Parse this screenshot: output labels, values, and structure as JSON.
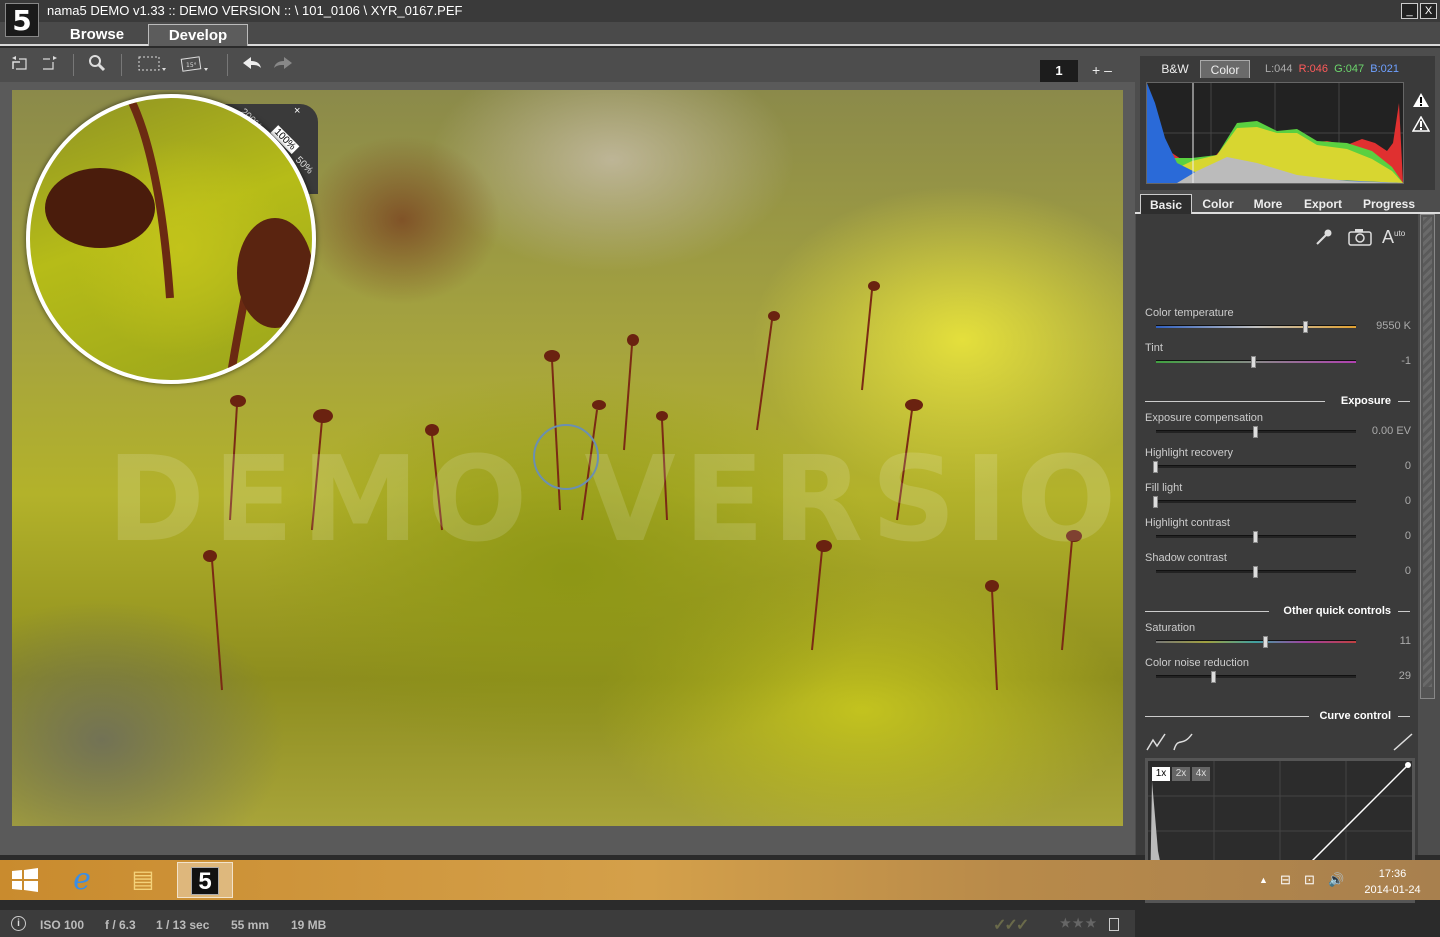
{
  "window": {
    "logo": "5",
    "title": "nama5 DEMO v1.33 :: DEMO VERSION :: \\ 101_0106 \\ XYR_0167.PEF",
    "minimize_glyph": "_",
    "close_glyph": "X"
  },
  "mode_tabs": {
    "browse": "Browse",
    "develop": "Develop",
    "active": "Develop"
  },
  "toolbar": {
    "page_number": "1",
    "zoom_controls": "+ –"
  },
  "image": {
    "watermark": "DEMO VERSION",
    "loupe": {
      "zoom_levels": [
        "200%",
        "100%",
        "50%"
      ],
      "selected_zoom": "100%",
      "close_glyph": "×"
    }
  },
  "status": {
    "info_glyph": "i",
    "iso": "ISO 100",
    "aperture": "f / 6.3",
    "shutter": "1 / 13 sec",
    "focal_length": "55 mm",
    "file_size": "19 MB",
    "checks": "✓✓✓",
    "stars": "★★★"
  },
  "histogram": {
    "tabs": [
      "B&W",
      "Color"
    ],
    "active_tab": "Color",
    "l_value": "L:044",
    "r_value": "R:046",
    "g_value": "G:047",
    "b_value": "B:021",
    "colors": {
      "l": "#aaaaaa",
      "r": "#ff5a5a",
      "g": "#6cd66c",
      "b": "#6ea0ff"
    }
  },
  "panel_tabs": [
    "Basic",
    "Color",
    "More",
    "Export",
    "Progress"
  ],
  "active_panel_tab": "Basic",
  "basic": {
    "auto_label": "A",
    "auto_sup": "uto",
    "color_temperature": {
      "label": "Color temperature",
      "value": "9550 K",
      "position": 0.75
    },
    "tint": {
      "label": "Tint",
      "value": "-1",
      "position": 0.49
    },
    "exposure_section": "Exposure",
    "exposure_compensation": {
      "label": "Exposure compensation",
      "value": "0.00 EV",
      "position": 0.5
    },
    "highlight_recovery": {
      "label": "Highlight recovery",
      "value": "0",
      "position": 0.0
    },
    "fill_light": {
      "label": "Fill light",
      "value": "0",
      "position": 0.0
    },
    "highlight_contrast": {
      "label": "Highlight contrast",
      "value": "0",
      "position": 0.5
    },
    "shadow_contrast": {
      "label": "Shadow contrast",
      "value": "0",
      "position": 0.5
    },
    "other_section": "Other quick controls",
    "saturation": {
      "label": "Saturation",
      "value": "11",
      "position": 0.55
    },
    "color_noise_reduction": {
      "label": "Color noise reduction",
      "value": "29",
      "position": 0.29
    },
    "curve_section": "Curve control",
    "curve_zoom": [
      "1x",
      "2x",
      "4x"
    ],
    "curve_zoom_selected": "1x"
  },
  "taskbar": {
    "apps": [
      "e",
      "▤",
      "5"
    ],
    "tray": [
      "▲",
      "⊟",
      "⊡",
      "🔊"
    ],
    "time": "17:36",
    "date": "2014-01-24"
  }
}
